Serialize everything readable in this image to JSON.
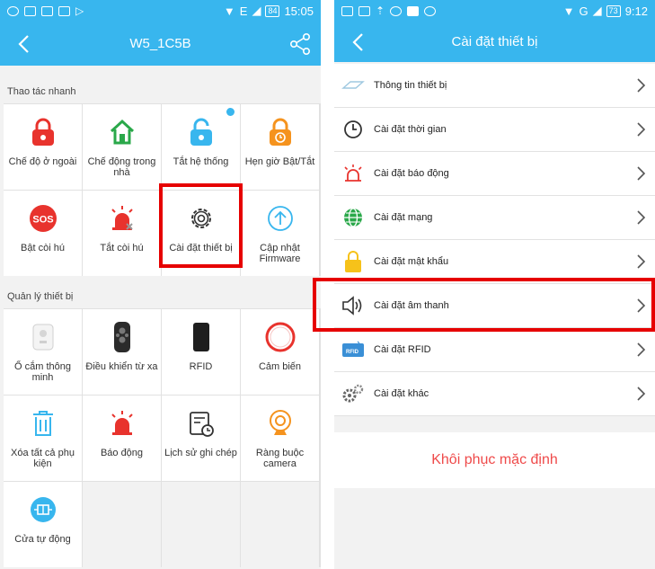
{
  "left": {
    "status": {
      "time": "15:05",
      "battery": "84",
      "network": "E"
    },
    "title": "W5_1C5B",
    "quick_section": "Thao tác nhanh",
    "quick_items": [
      {
        "label": "Chế độ ở ngoài",
        "icon": "lock-away-icon"
      },
      {
        "label": "Chế động trong nhà",
        "icon": "home-icon"
      },
      {
        "label": "Tắt hệ thống",
        "icon": "unlock-icon"
      },
      {
        "label": "Hẹn giờ Bật/Tắt",
        "icon": "lock-timer-icon"
      },
      {
        "label": "Bật còi hú",
        "icon": "sos-icon"
      },
      {
        "label": "Tắt còi hú",
        "icon": "alarm-off-icon"
      },
      {
        "label": "Cài đặt thiết bị",
        "icon": "gear-icon"
      },
      {
        "label": "Cập nhật Firmware",
        "icon": "upload-icon"
      }
    ],
    "device_section": "Quản lý thiết bị",
    "device_items": [
      {
        "label": "Ổ cắm thông minh",
        "icon": "smart-plug-icon"
      },
      {
        "label": "Điều khiển từ xa",
        "icon": "remote-icon"
      },
      {
        "label": "RFID",
        "icon": "rfid-tag-icon"
      },
      {
        "label": "Cảm biến",
        "icon": "sensor-icon"
      },
      {
        "label": "Xóa tất cả phụ kiện",
        "icon": "trash-icon"
      },
      {
        "label": "Báo động",
        "icon": "alarm-icon"
      },
      {
        "label": "Lịch sử ghi chép",
        "icon": "history-icon"
      },
      {
        "label": "Ràng buộc camera",
        "icon": "camera-icon"
      },
      {
        "label": "Cửa tự động",
        "icon": "door-icon"
      }
    ]
  },
  "right": {
    "status": {
      "time": "9:12",
      "battery": "73",
      "network": "G"
    },
    "title": "Cài đặt thiết bị",
    "menu": [
      {
        "label": "Thông tin thiết bị",
        "icon": "info-icon"
      },
      {
        "label": "Cài đặt thời gian",
        "icon": "clock-icon"
      },
      {
        "label": "Cài đặt báo động",
        "icon": "alarm-icon"
      },
      {
        "label": "Cài đặt mạng",
        "icon": "globe-icon"
      },
      {
        "label": "Cài đặt mật khẩu",
        "icon": "lock-icon"
      },
      {
        "label": "Cài đặt âm thanh",
        "icon": "speaker-icon"
      },
      {
        "label": "Cài đặt RFID",
        "icon": "rfid-icon"
      },
      {
        "label": "Cài đặt khác",
        "icon": "gears-icon"
      }
    ],
    "restore_label": "Khôi phục mặc định"
  },
  "colors": {
    "primary": "#38b6ee",
    "orange": "#f5931e",
    "red": "#e8332d",
    "green": "#2aa84a",
    "highlight": "#e60000"
  }
}
